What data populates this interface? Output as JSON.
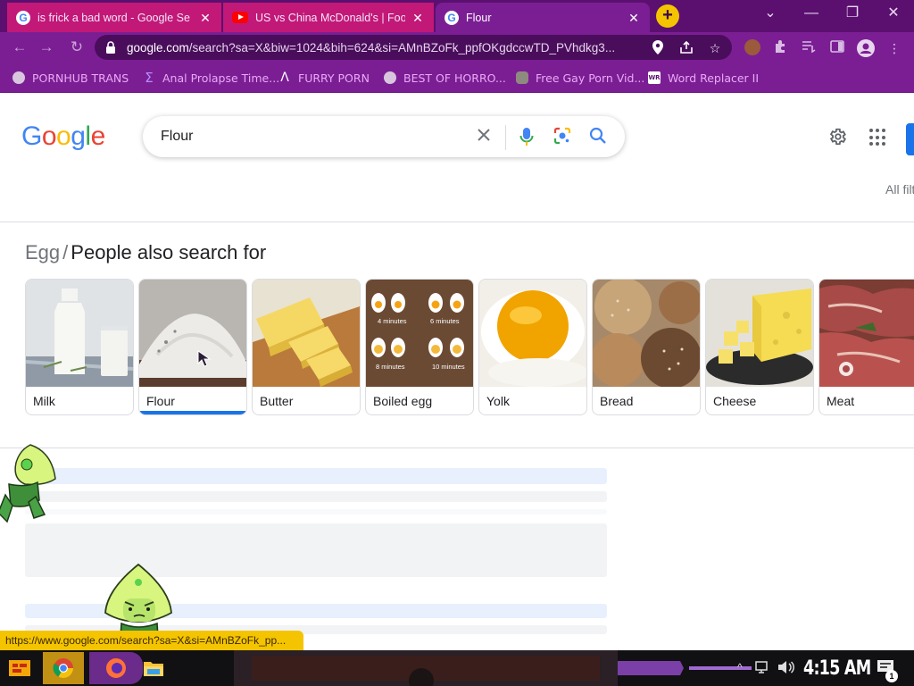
{
  "window": {
    "tabs": [
      {
        "title": "is frick a bad word - Google Se",
        "favicon": "google-favicon",
        "active": false
      },
      {
        "title": "US vs China McDonald's | Food",
        "favicon": "youtube-favicon",
        "active": false
      },
      {
        "title": "Flour",
        "favicon": "google-favicon",
        "active": true
      }
    ],
    "close_glyph": "✕",
    "new_tab_glyph": "+",
    "controls": {
      "tab_search": "⌄",
      "minimize": "—",
      "restore": "❐",
      "close": "✕"
    }
  },
  "address_bar": {
    "domain": "google.com",
    "path": "/search?sa=X&biw=1024&bih=624&si=AMnBZoFk_ppfOKgdccwTD_PVhdkg3..."
  },
  "bookmarks": [
    {
      "label": "PORNHUB TRANS",
      "icon": "globe-icon"
    },
    {
      "label": "Anal Prolapse Time...",
      "icon": "sigma-icon"
    },
    {
      "label": "FURRY PORN",
      "icon": "lambda-icon"
    },
    {
      "label": "BEST OF HORRO...",
      "icon": "globe-icon"
    },
    {
      "label": "Free Gay Porn Vid...",
      "icon": "bear-icon"
    },
    {
      "label": "Word Replacer II",
      "icon": "wr-icon"
    }
  ],
  "google": {
    "logo": "Google",
    "query": "Flour",
    "all_filters": "All filters"
  },
  "people_also_search": {
    "crumb": "Egg",
    "separator": "/",
    "heading": "People also search for",
    "items": [
      {
        "label": "Milk",
        "selected": false
      },
      {
        "label": "Flour",
        "selected": true
      },
      {
        "label": "Butter",
        "selected": false
      },
      {
        "label": "Boiled egg",
        "selected": false,
        "captions": [
          "4 minutes",
          "6 minutes",
          "8 minutes",
          "10 minutes"
        ]
      },
      {
        "label": "Yolk",
        "selected": false
      },
      {
        "label": "Bread",
        "selected": false
      },
      {
        "label": "Cheese",
        "selected": false
      },
      {
        "label": "Meat",
        "selected": false
      }
    ]
  },
  "status_bar": {
    "url": "https://www.google.com/search?sa=X&si=AMnBZoFk_pp..."
  },
  "taskbar": {
    "clock": "4:15 AM",
    "notification_count": "1",
    "accent": "#c29012"
  },
  "colors": {
    "tab_strip": "#5b1070",
    "toolbar": "#7b1e94",
    "inactive_tab": "#c21878",
    "bookmark_text": "#e9a9f5",
    "google_blue": "#1a73e8"
  }
}
